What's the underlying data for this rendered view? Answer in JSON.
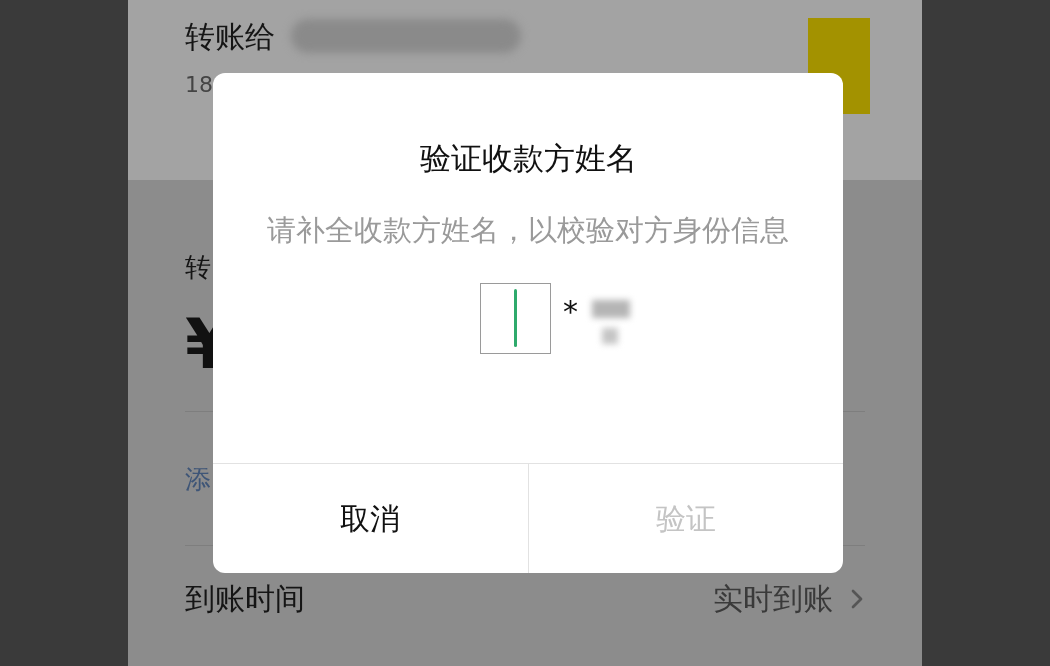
{
  "page": {
    "recipient_label": "转账给",
    "phone_partial": "18",
    "amount_label_partial": "转",
    "currency_partial": "¥",
    "add_note_partial": "添",
    "arrival_label": "到账时间",
    "arrival_value": "实时到账"
  },
  "dialog": {
    "title": "验证收款方姓名",
    "message": "请补全收款方姓名，以校验对方身份信息",
    "name_field": {
      "focused": true
    },
    "name_prefix": "*",
    "buttons": [
      {
        "label": "取消",
        "disabled": false
      },
      {
        "label": "验证",
        "disabled": true
      }
    ]
  }
}
